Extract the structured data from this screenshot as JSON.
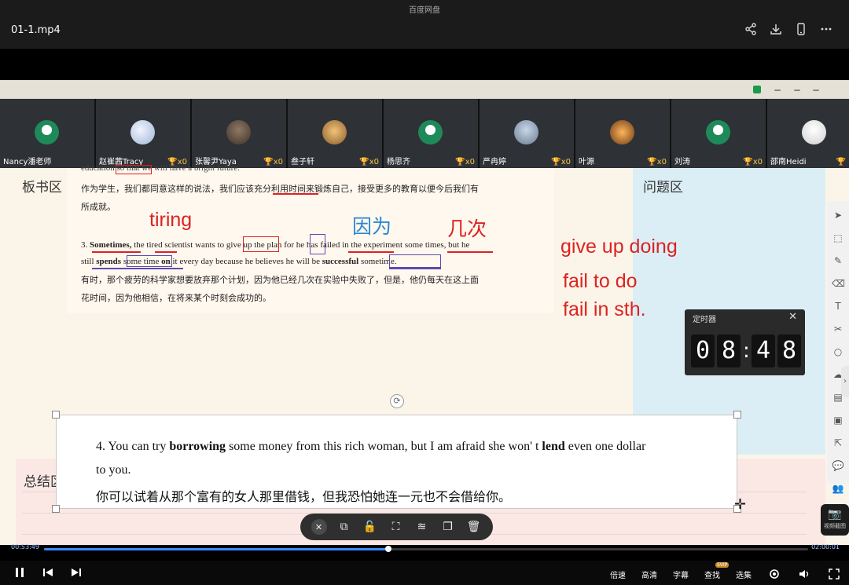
{
  "app_title": "百度网盘",
  "file_title": "01-1.mp4",
  "top_icons": [
    "share-icon",
    "download-icon",
    "phone-icon",
    "more-icon"
  ],
  "participants": [
    {
      "name": "Nancy潘老师",
      "cup": ""
    },
    {
      "name": "赵崔茜Tracy",
      "cup": "x0"
    },
    {
      "name": "张馨尹Yaya",
      "cup": "x0"
    },
    {
      "name": "叁子轩",
      "cup": "x0"
    },
    {
      "name": "杨思齐",
      "cup": "x0"
    },
    {
      "name": "严冉婷",
      "cup": "x0"
    },
    {
      "name": "叶源",
      "cup": "x0"
    },
    {
      "name": "刘涛",
      "cup": "x0"
    },
    {
      "name": "邵南Heidi",
      "cup": ""
    }
  ],
  "board": {
    "zone_board": "板书区",
    "zone_question": "问题区",
    "zone_summary": "总结区",
    "doc": {
      "line_top": "education so that we will have a bright future.",
      "cn1": "作为学生，我们都同意这样的说法，我们应该充分利用时间来锻炼自己，接受更多的教育以便今后我们有",
      "cn2": "所成就。",
      "s3_a": "3.",
      "s3_b": "Sometimes,",
      "s3_c": "the tired scientist wants to",
      "s3_d": "give up",
      "s3_e": "the plan",
      "s3_f": "for",
      "s3_g": "he has",
      "s3_h": "failed in",
      "s3_i": "the experiment",
      "s3_j": "some times,",
      "s3_k": "but he",
      "s3_l1": "still",
      "s3_l2": "spends",
      "s3_l3": "some time",
      "s3_l4": "on",
      "s3_l5": "it every day because he believes he will be",
      "s3_l6": "successful",
      "s3_l7": "sometime.",
      "cn3": "有时，那个疲劳的科学家想要放弃那个计划，因为他已经几次在实验中失败了，但是，他仍每天在这上面",
      "cn4": "花时间，因为他相信，在将来某个时刻会成功的。"
    },
    "handwriting": {
      "tiring": "tiring",
      "because": "因为",
      "times": "几次",
      "give_up": "give up doing",
      "fail_to": "fail to do",
      "fail_in": "fail in sth."
    },
    "sentence4": {
      "prefix": "4.  You can try ",
      "bold1": "borrowing",
      "mid": " some money from this rich woman, but I am afraid she won' t   ",
      "bold2": "lend",
      "suffix": " even one dollar",
      "line2": "to you.",
      "cn": "你可以试着从那个富有的女人那里借钱，但我恐怕她连一元也不会借给你。"
    },
    "timer": {
      "title": "定时器",
      "digits": [
        "0",
        "8",
        "4",
        "8"
      ]
    },
    "capture_label": "视频截图"
  },
  "player": {
    "current_time": "00:53:49",
    "total_time": "02:00:01",
    "progress": 0.451,
    "controls_right": {
      "speed": "倍速",
      "quality": "高清",
      "subtitle": "字幕",
      "search": "查找",
      "svip": "SVIP",
      "episodes": "选集"
    }
  }
}
